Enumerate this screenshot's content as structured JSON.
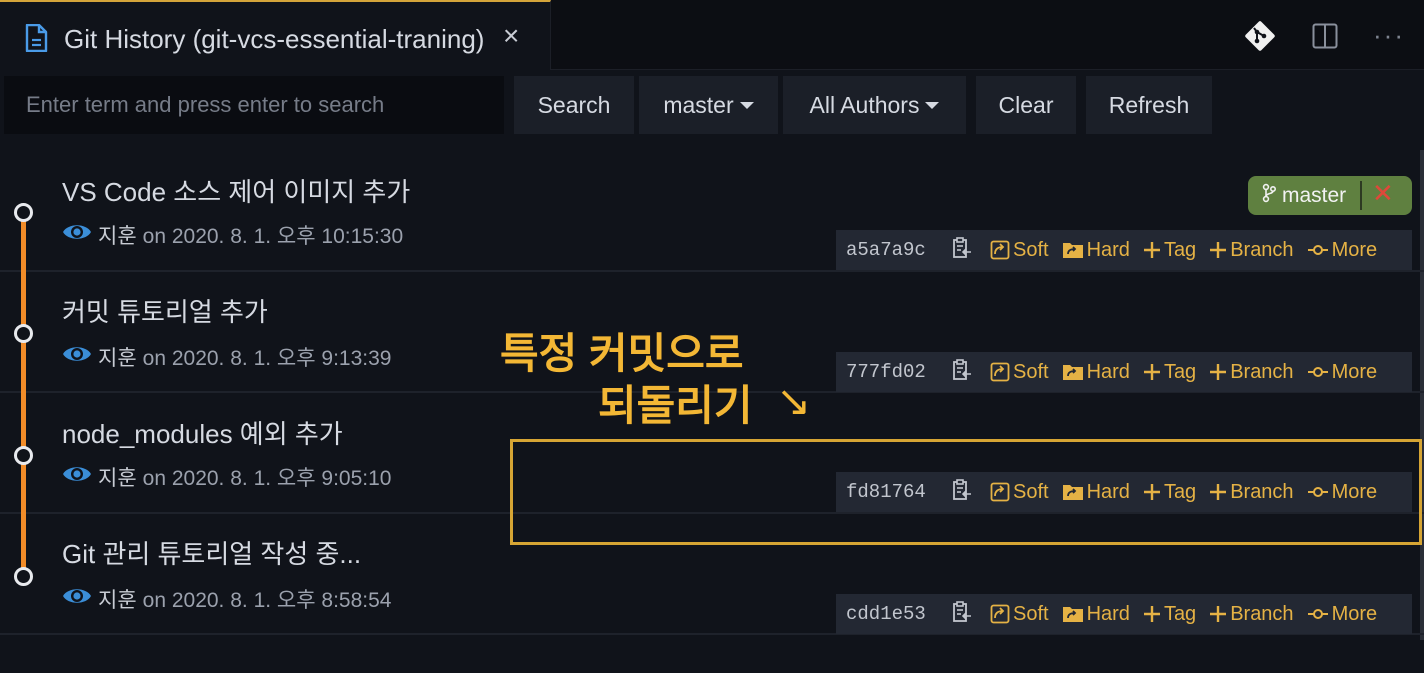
{
  "tab": {
    "title": "Git History (git-vcs-essential-traning)",
    "close": "×"
  },
  "toolbar": {
    "search_placeholder": "Enter term and press enter to search",
    "search_label": "Search",
    "branch_label": "master",
    "authors_label": "All Authors",
    "clear_label": "Clear",
    "refresh_label": "Refresh"
  },
  "branch_badge": {
    "label": "master",
    "remove": "✕"
  },
  "actions": {
    "soft": "Soft",
    "hard": "Hard",
    "tag": "Tag",
    "branch": "Branch",
    "more": "More"
  },
  "commits": [
    {
      "message": "VS Code 소스 제어 이미지 추가",
      "author": "지훈",
      "date": "on 2020. 8. 1. 오후 10:15:30",
      "hash": "a5a7a9c"
    },
    {
      "message": "커밋 튜토리얼 추가",
      "author": "지훈",
      "date": "on 2020. 8. 1. 오후 9:13:39",
      "hash": "777fd02"
    },
    {
      "message": "node_modules 예외 추가",
      "author": "지훈",
      "date": "on 2020. 8. 1. 오후 9:05:10",
      "hash": "fd81764"
    },
    {
      "message": "Git 관리 튜토리얼 작성 중...",
      "author": "지훈",
      "date": "on 2020. 8. 1. 오후 8:58:54",
      "hash": "cdd1e53"
    }
  ],
  "annotation": {
    "line1": "특정 커밋으로",
    "line2": "되돌리기",
    "arrow": "↘"
  },
  "colors": {
    "accent": "#e5b245",
    "graph": "#f28c28",
    "badge": "#5f8040",
    "highlight": "#d6a534"
  }
}
